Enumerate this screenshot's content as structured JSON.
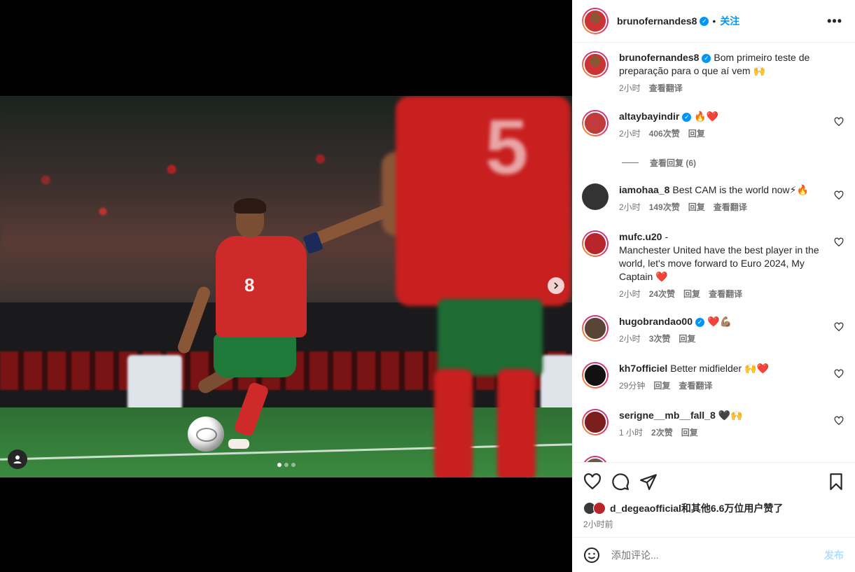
{
  "post": {
    "author": "brunofernandes8",
    "follow_label": "关注",
    "separator": "•",
    "more_label": "•••",
    "caption_text": "Bom primeiro teste de preparação para o que aí vem 🙌",
    "caption_time": "2小时",
    "caption_translate": "查看翻译"
  },
  "comments": [
    {
      "user": "altaybayindir",
      "verified": true,
      "text": "🔥❤️",
      "time": "2小时",
      "likes": "406次赞",
      "reply": "回复",
      "translate": "",
      "avatar_color": "#c23b3b"
    },
    {
      "user": "iamohaa_8",
      "verified": false,
      "text": "Best CAM is the world now⚡🔥",
      "time": "2小时",
      "likes": "149次赞",
      "reply": "回复",
      "translate": "查看翻译",
      "avatar_color": "#333333"
    },
    {
      "user": "mufc.u20",
      "verified": false,
      "text": "-\nManchester United have the best player in the world, let's move forward to Euro 2024, My Captain ❤️",
      "time": "2小时",
      "likes": "24次赞",
      "reply": "回复",
      "translate": "查看翻译",
      "avatar_color": "#b8262c"
    },
    {
      "user": "hugobrandao00",
      "verified": true,
      "text": "❤️💪🏽",
      "time": "2小时",
      "likes": "3次赞",
      "reply": "回复",
      "translate": "",
      "avatar_color": "#5a4436"
    },
    {
      "user": "kh7officiel",
      "verified": false,
      "text": "Better midfielder 🙌❤️",
      "time": "29分钟",
      "likes": "",
      "reply": "回复",
      "translate": "查看翻译",
      "avatar_color": "#111111"
    },
    {
      "user": "serigne__mb__fall_8",
      "verified": false,
      "text": "🖤🙌",
      "time": "1 小时",
      "likes": "2次赞",
      "reply": "回复",
      "translate": "",
      "avatar_color": "#7a1e1e"
    }
  ],
  "view_replies": "查看回复 (6)",
  "likes_summary": {
    "user": "d_degeaofficial",
    "rest": "和其他6.6万位用户赞了",
    "time": "2小时前"
  },
  "comment_input": {
    "placeholder": "添加评论...",
    "post_label": "发布"
  },
  "carousel": {
    "current": 1,
    "total": 3
  },
  "photo": {
    "player_number": "8",
    "foreground_number": "5"
  },
  "colors": {
    "accent": "#0095f6",
    "post_disabled": "#b2dffc",
    "muted": "#737373"
  }
}
